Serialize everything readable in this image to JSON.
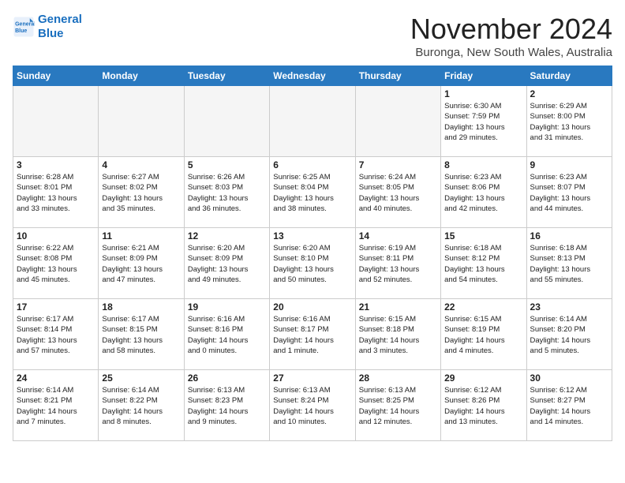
{
  "header": {
    "logo_line1": "General",
    "logo_line2": "Blue",
    "month_title": "November 2024",
    "location": "Buronga, New South Wales, Australia"
  },
  "days_of_week": [
    "Sunday",
    "Monday",
    "Tuesday",
    "Wednesday",
    "Thursday",
    "Friday",
    "Saturday"
  ],
  "weeks": [
    [
      {
        "day": "",
        "info": ""
      },
      {
        "day": "",
        "info": ""
      },
      {
        "day": "",
        "info": ""
      },
      {
        "day": "",
        "info": ""
      },
      {
        "day": "",
        "info": ""
      },
      {
        "day": "1",
        "info": "Sunrise: 6:30 AM\nSunset: 7:59 PM\nDaylight: 13 hours\nand 29 minutes."
      },
      {
        "day": "2",
        "info": "Sunrise: 6:29 AM\nSunset: 8:00 PM\nDaylight: 13 hours\nand 31 minutes."
      }
    ],
    [
      {
        "day": "3",
        "info": "Sunrise: 6:28 AM\nSunset: 8:01 PM\nDaylight: 13 hours\nand 33 minutes."
      },
      {
        "day": "4",
        "info": "Sunrise: 6:27 AM\nSunset: 8:02 PM\nDaylight: 13 hours\nand 35 minutes."
      },
      {
        "day": "5",
        "info": "Sunrise: 6:26 AM\nSunset: 8:03 PM\nDaylight: 13 hours\nand 36 minutes."
      },
      {
        "day": "6",
        "info": "Sunrise: 6:25 AM\nSunset: 8:04 PM\nDaylight: 13 hours\nand 38 minutes."
      },
      {
        "day": "7",
        "info": "Sunrise: 6:24 AM\nSunset: 8:05 PM\nDaylight: 13 hours\nand 40 minutes."
      },
      {
        "day": "8",
        "info": "Sunrise: 6:23 AM\nSunset: 8:06 PM\nDaylight: 13 hours\nand 42 minutes."
      },
      {
        "day": "9",
        "info": "Sunrise: 6:23 AM\nSunset: 8:07 PM\nDaylight: 13 hours\nand 44 minutes."
      }
    ],
    [
      {
        "day": "10",
        "info": "Sunrise: 6:22 AM\nSunset: 8:08 PM\nDaylight: 13 hours\nand 45 minutes."
      },
      {
        "day": "11",
        "info": "Sunrise: 6:21 AM\nSunset: 8:09 PM\nDaylight: 13 hours\nand 47 minutes."
      },
      {
        "day": "12",
        "info": "Sunrise: 6:20 AM\nSunset: 8:09 PM\nDaylight: 13 hours\nand 49 minutes."
      },
      {
        "day": "13",
        "info": "Sunrise: 6:20 AM\nSunset: 8:10 PM\nDaylight: 13 hours\nand 50 minutes."
      },
      {
        "day": "14",
        "info": "Sunrise: 6:19 AM\nSunset: 8:11 PM\nDaylight: 13 hours\nand 52 minutes."
      },
      {
        "day": "15",
        "info": "Sunrise: 6:18 AM\nSunset: 8:12 PM\nDaylight: 13 hours\nand 54 minutes."
      },
      {
        "day": "16",
        "info": "Sunrise: 6:18 AM\nSunset: 8:13 PM\nDaylight: 13 hours\nand 55 minutes."
      }
    ],
    [
      {
        "day": "17",
        "info": "Sunrise: 6:17 AM\nSunset: 8:14 PM\nDaylight: 13 hours\nand 57 minutes."
      },
      {
        "day": "18",
        "info": "Sunrise: 6:17 AM\nSunset: 8:15 PM\nDaylight: 13 hours\nand 58 minutes."
      },
      {
        "day": "19",
        "info": "Sunrise: 6:16 AM\nSunset: 8:16 PM\nDaylight: 14 hours\nand 0 minutes."
      },
      {
        "day": "20",
        "info": "Sunrise: 6:16 AM\nSunset: 8:17 PM\nDaylight: 14 hours\nand 1 minute."
      },
      {
        "day": "21",
        "info": "Sunrise: 6:15 AM\nSunset: 8:18 PM\nDaylight: 14 hours\nand 3 minutes."
      },
      {
        "day": "22",
        "info": "Sunrise: 6:15 AM\nSunset: 8:19 PM\nDaylight: 14 hours\nand 4 minutes."
      },
      {
        "day": "23",
        "info": "Sunrise: 6:14 AM\nSunset: 8:20 PM\nDaylight: 14 hours\nand 5 minutes."
      }
    ],
    [
      {
        "day": "24",
        "info": "Sunrise: 6:14 AM\nSunset: 8:21 PM\nDaylight: 14 hours\nand 7 minutes."
      },
      {
        "day": "25",
        "info": "Sunrise: 6:14 AM\nSunset: 8:22 PM\nDaylight: 14 hours\nand 8 minutes."
      },
      {
        "day": "26",
        "info": "Sunrise: 6:13 AM\nSunset: 8:23 PM\nDaylight: 14 hours\nand 9 minutes."
      },
      {
        "day": "27",
        "info": "Sunrise: 6:13 AM\nSunset: 8:24 PM\nDaylight: 14 hours\nand 10 minutes."
      },
      {
        "day": "28",
        "info": "Sunrise: 6:13 AM\nSunset: 8:25 PM\nDaylight: 14 hours\nand 12 minutes."
      },
      {
        "day": "29",
        "info": "Sunrise: 6:12 AM\nSunset: 8:26 PM\nDaylight: 14 hours\nand 13 minutes."
      },
      {
        "day": "30",
        "info": "Sunrise: 6:12 AM\nSunset: 8:27 PM\nDaylight: 14 hours\nand 14 minutes."
      }
    ]
  ]
}
